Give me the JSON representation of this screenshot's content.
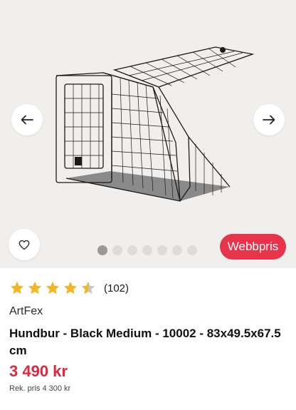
{
  "gallery": {
    "image_alt": "Hundbur - Black Medium",
    "slide_count": 7,
    "active_slide": 1,
    "badge_label": "Webbpris"
  },
  "product": {
    "rating": 4.5,
    "review_count": "(102)",
    "brand": "ArtFex",
    "title": "Hundbur - Black Medium - 10002 - 83x49.5x67.5 cm",
    "price": "3 490 kr",
    "rec_price": "Rek. pris 4 300 kr"
  },
  "colors": {
    "accent": "#e8334a",
    "star": "#f4b51f",
    "price": "#e3263f"
  },
  "icons": {
    "prev": "arrow-left-icon",
    "next": "arrow-right-icon",
    "favorite": "heart-icon",
    "star": "star-icon"
  }
}
